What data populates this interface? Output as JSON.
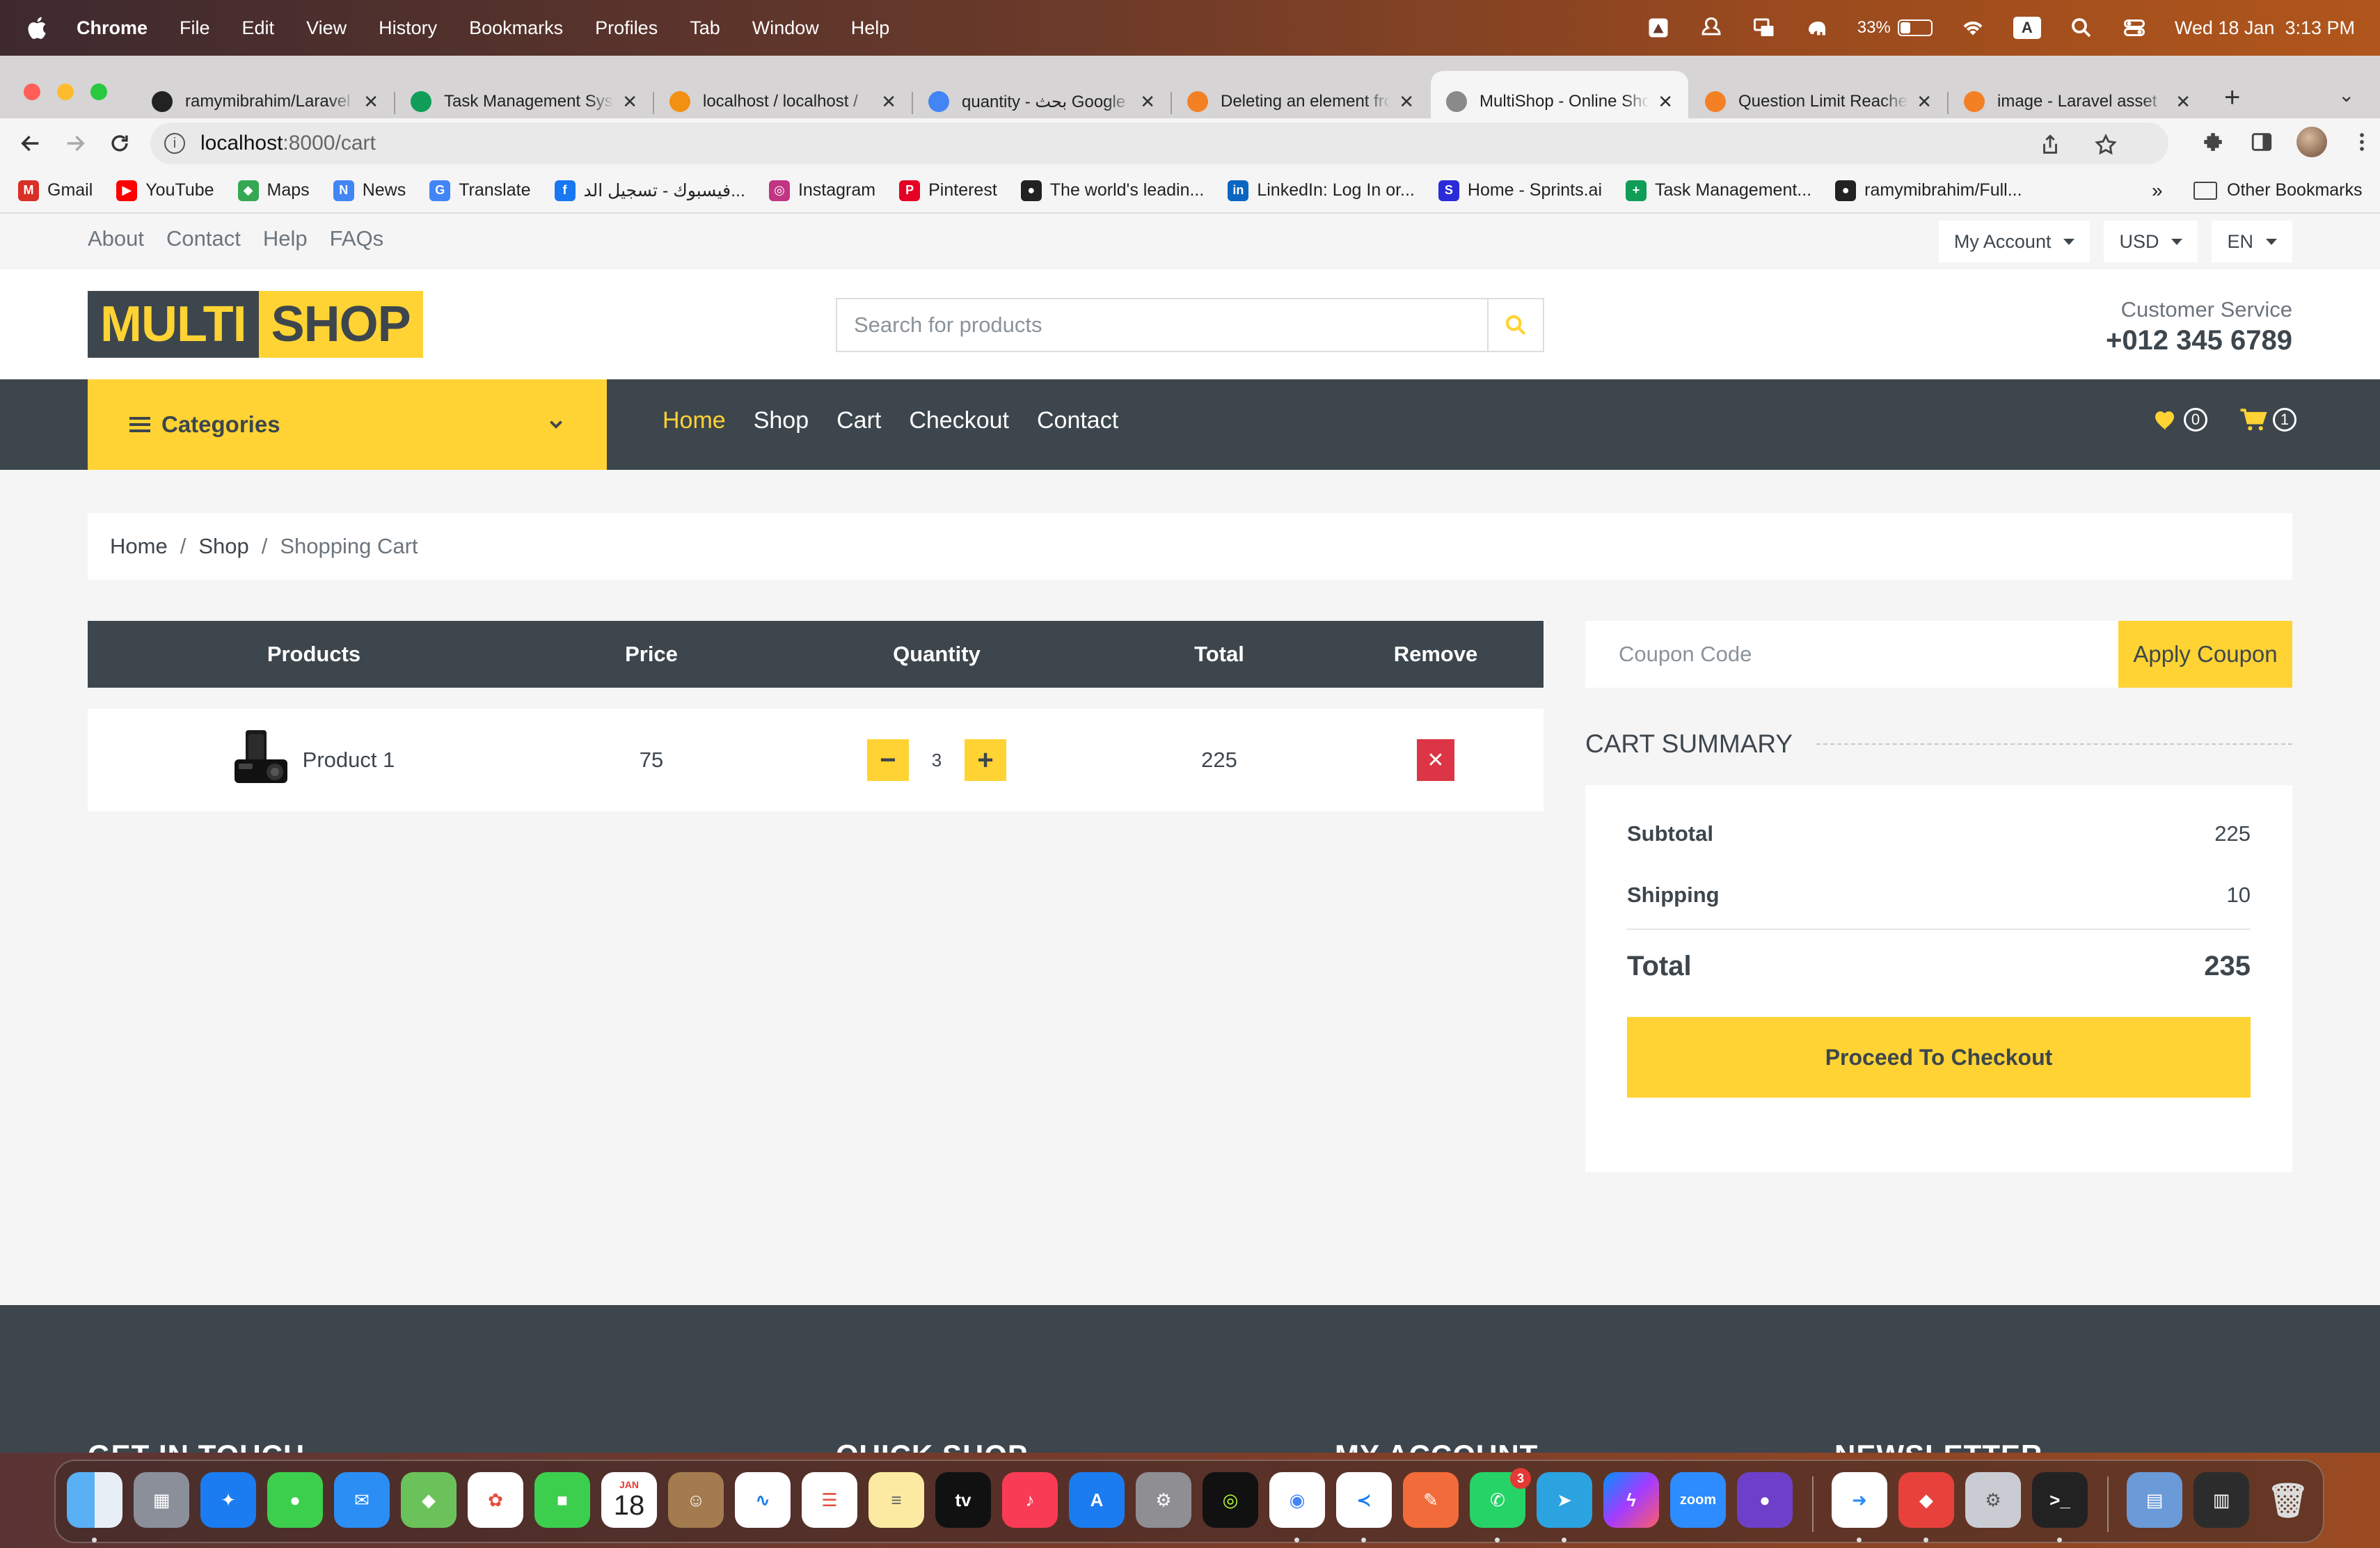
{
  "menubar": {
    "app": "Chrome",
    "items": [
      "File",
      "Edit",
      "View",
      "History",
      "Bookmarks",
      "Profiles",
      "Tab",
      "Window",
      "Help"
    ],
    "battery": "33%",
    "battery_level": 0.33,
    "input_source": "A",
    "datetime": "Wed 18 Jan  3:13 PM"
  },
  "tabs": [
    {
      "title": "ramymibrahim/Laravel",
      "icon": "github-icon",
      "active": false
    },
    {
      "title": "Task Management System",
      "icon": "sheets-icon",
      "active": false
    },
    {
      "title": "localhost / localhost /",
      "icon": "phpmyadmin-icon",
      "active": false
    },
    {
      "title": "quantity - بحث Google",
      "icon": "google-icon",
      "active": false
    },
    {
      "title": "Deleting an element from",
      "icon": "stackoverflow-icon",
      "active": false
    },
    {
      "title": "MultiShop - Online Shop",
      "icon": "globe-icon",
      "active": true
    },
    {
      "title": "Question Limit Reached",
      "icon": "stackoverflow-icon",
      "active": false
    },
    {
      "title": "image - Laravel asset",
      "icon": "stackoverflow-icon",
      "active": false
    }
  ],
  "address": {
    "host": "localhost",
    "path": ":8000/cart"
  },
  "bookmarks": [
    {
      "label": "Gmail",
      "color": "#d93025",
      "glyph": "M"
    },
    {
      "label": "YouTube",
      "color": "#ff0000",
      "glyph": "▶"
    },
    {
      "label": "Maps",
      "color": "#34a853",
      "glyph": "◆"
    },
    {
      "label": "News",
      "color": "#4285f4",
      "glyph": "N"
    },
    {
      "label": "Translate",
      "color": "#4285f4",
      "glyph": "G"
    },
    {
      "label": "فيسبوك - تسجيل الد...",
      "color": "#1877f2",
      "glyph": "f"
    },
    {
      "label": "Instagram",
      "color": "#c13584",
      "glyph": "◎"
    },
    {
      "label": "Pinterest",
      "color": "#e60023",
      "glyph": "P"
    },
    {
      "label": "The world's leadin...",
      "color": "#222222",
      "glyph": "●"
    },
    {
      "label": "LinkedIn: Log In or...",
      "color": "#0a66c2",
      "glyph": "in"
    },
    {
      "label": "Home - Sprints.ai",
      "color": "#2b2bd9",
      "glyph": "S"
    },
    {
      "label": "Task Management...",
      "color": "#0f9d58",
      "glyph": "+"
    },
    {
      "label": "ramymibrahim/Full...",
      "color": "#222222",
      "glyph": "●"
    }
  ],
  "bookmarks_more": "»",
  "other_bookmarks": "Other Bookmarks",
  "site": {
    "top_links": [
      "About",
      "Contact",
      "Help",
      "FAQs"
    ],
    "account": "My Account",
    "currency": "USD",
    "language": "EN",
    "logo_part1": "MULTI",
    "logo_part2": "SHOP",
    "search_placeholder": "Search for products",
    "customer_service_label": "Customer Service",
    "customer_service_phone": "+012 345 6789",
    "categories": "Categories",
    "nav": [
      "Home",
      "Shop",
      "Cart",
      "Checkout",
      "Contact"
    ],
    "wishlist_count": "0",
    "cart_count": "1",
    "accent": "#ffd333",
    "dark": "#3d464d"
  },
  "breadcrumb": [
    "Home",
    "Shop",
    "Shopping Cart"
  ],
  "cart": {
    "headers": [
      "Products",
      "Price",
      "Quantity",
      "Total",
      "Remove"
    ],
    "rows": [
      {
        "product": "Product 1",
        "price": "75",
        "quantity": "3",
        "total": "225"
      }
    ],
    "minus": "−",
    "plus": "+",
    "remove": "✕"
  },
  "coupon": {
    "placeholder": "Coupon Code",
    "button": "Apply Coupon"
  },
  "summary": {
    "title": "Cart Summary",
    "subtotal_label": "Subtotal",
    "subtotal": "225",
    "shipping_label": "Shipping",
    "shipping": "10",
    "total_label": "Total",
    "total": "235",
    "checkout": "Proceed To Checkout"
  },
  "footer_titles": [
    "GET IN TOUCH",
    "QUICK SHOP",
    "MY ACCOUNT",
    "NEWSLETTER"
  ],
  "dock": {
    "whatsapp_badge": "3",
    "calendar_month": "JAN",
    "calendar_day": "18",
    "tv_label": "tv",
    "zoom_label": "zoom"
  }
}
